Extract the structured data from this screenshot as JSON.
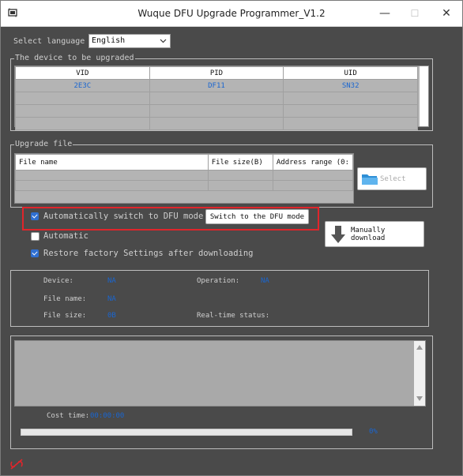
{
  "window": {
    "title": "Wuque DFU Upgrade Programmer_V1.2",
    "minimize": "—",
    "maximize": "☐",
    "close": "✕"
  },
  "language": {
    "label": "Select language",
    "value": "English"
  },
  "device_group": {
    "legend": "The device to be upgraded",
    "columns": [
      "VID",
      "PID",
      "UID"
    ],
    "rows": [
      [
        "2E3C",
        "DF11",
        "SN32"
      ]
    ]
  },
  "file_group": {
    "legend": "Upgrade file",
    "columns": [
      "File name",
      "File size(B)",
      "Address range (0:"
    ],
    "select_label": "Select"
  },
  "options": {
    "auto_switch": "Automatically switch to DFU mode",
    "switch_button": "Switch to the DFU mode",
    "automatic": "Automatic",
    "restore": "Restore factory Settings after downloading",
    "manual_download": "Manually download"
  },
  "status": {
    "device_label": "Device:",
    "device_value": "NA",
    "operation_label": "Operation:",
    "operation_value": "NA",
    "file_name_label": "File name:",
    "file_name_value": "NA",
    "file_size_label": "File size:",
    "file_size_value": "0B",
    "realtime_label": "Real-time status:",
    "realtime_value": ""
  },
  "log": {
    "cost_time_label": "Cost time:",
    "cost_time_value": "00:00:00",
    "progress_text": "0%",
    "progress": 0
  },
  "colors": {
    "accent": "#2f6fd1",
    "highlight_box": "#e0252b",
    "value_blue": "#1a66d0"
  },
  "icons": {
    "titlebar": "app-icon",
    "select": "folder-icon",
    "download": "down-arrow-icon",
    "footer": "link-off-icon"
  }
}
